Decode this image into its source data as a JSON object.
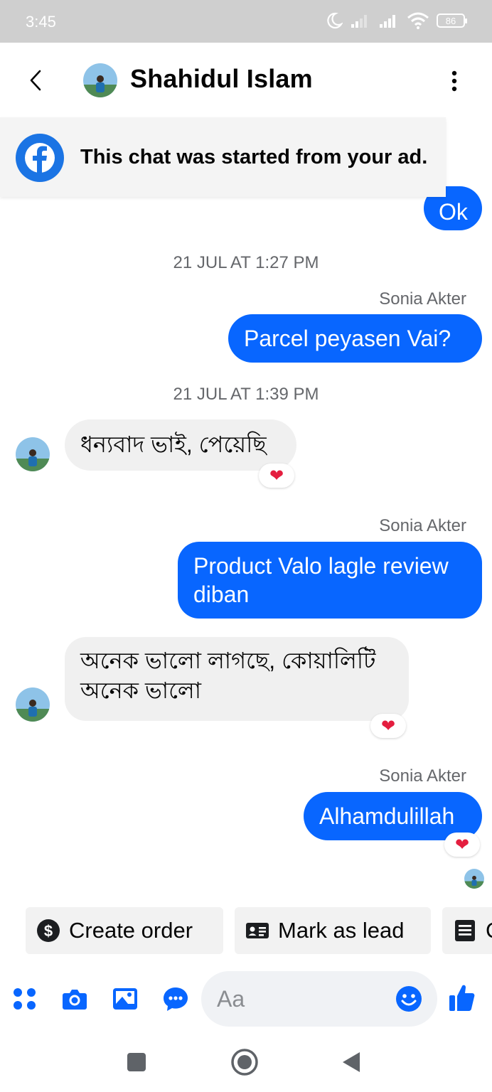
{
  "status_bar": {
    "time": "3:45",
    "battery": "86"
  },
  "header": {
    "contact_name": "Shahidul Islam"
  },
  "ad_banner": {
    "text": "This chat was started from your ad."
  },
  "messages": {
    "ok_text": "Ok",
    "ts1": "21 JUL AT 1:27 PM",
    "sender1": "Sonia Akter",
    "out1": "Parcel peyasen  Vai?",
    "ts2": "21 JUL AT 1:39 PM",
    "in1": "ধন্যবাদ ভাই, পেয়েছি",
    "sender2": "Sonia Akter",
    "out2": "Product Valo lagle review diban",
    "in2": "অনেক ভালো লাগছে, কোয়ালিটি অনেক ভালো",
    "sender3": "Sonia Akter",
    "out3": "Alhamdulillah",
    "reaction": "❤"
  },
  "quick_actions": [
    {
      "label": "Create order",
      "icon": "dollar-circle-icon"
    },
    {
      "label": "Mark as lead",
      "icon": "contact-card-icon"
    },
    {
      "label": "C",
      "icon": "document-icon"
    }
  ],
  "composer": {
    "placeholder": "Aa"
  },
  "colors": {
    "accent": "#0866ff",
    "brand": "#1b74e4",
    "heart": "#e41e3f",
    "incoming_bubble": "#f0f0f0"
  }
}
